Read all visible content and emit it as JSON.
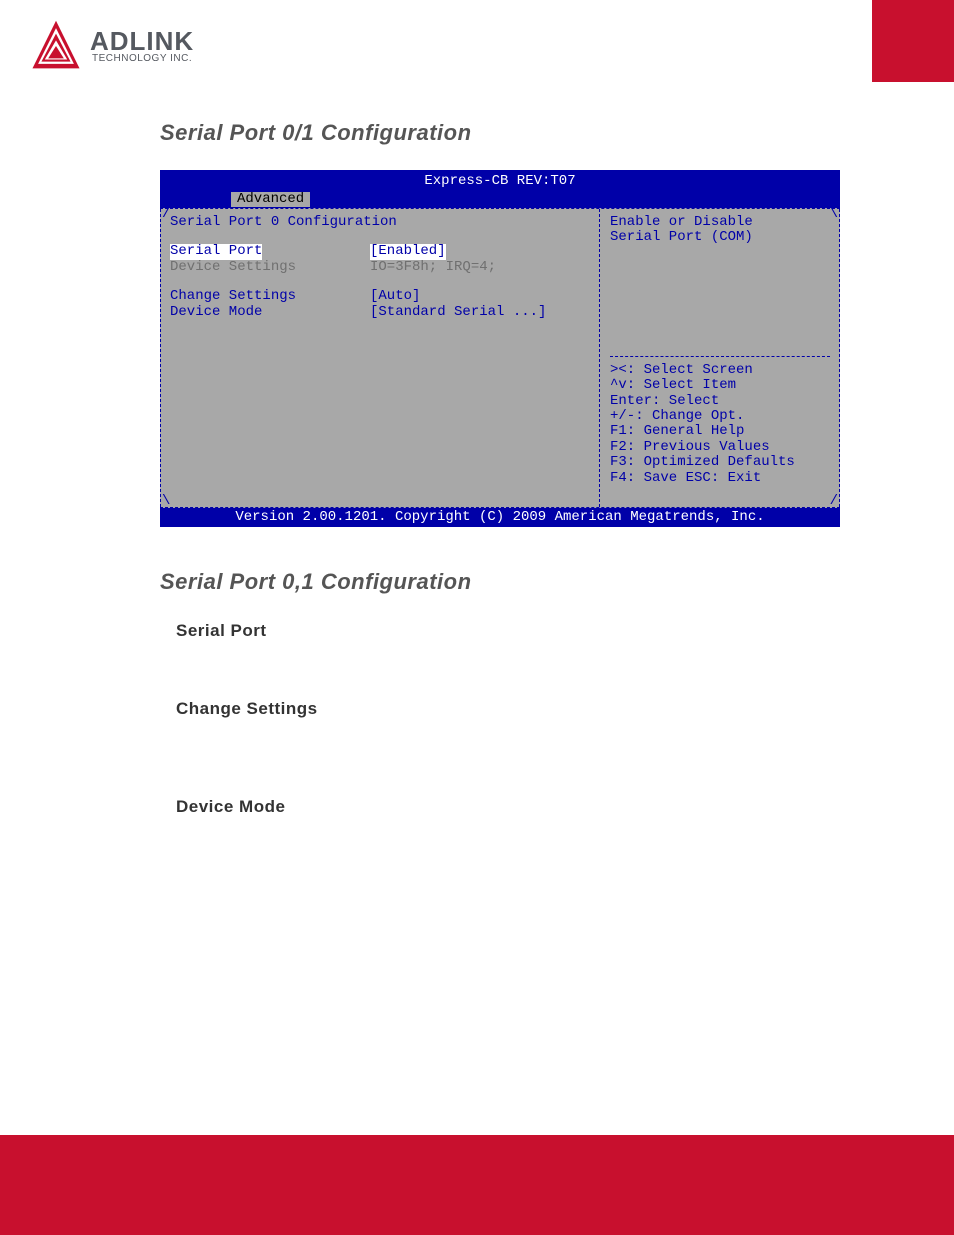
{
  "header": {
    "brand": "ADLINK",
    "subbrand": "TECHNOLOGY INC."
  },
  "doc": {
    "heading1": "Serial Port 0/1 Configuration",
    "heading2": "Serial Port 0,1 Configuration",
    "option1": "Serial Port",
    "option2": "Change Settings",
    "option3": "Device Mode"
  },
  "bios": {
    "title": "Express-CB REV:T07",
    "tab": "Advanced",
    "section_title": "Serial Port 0 Configuration",
    "rows": {
      "serial_port_k": "Serial Port",
      "serial_port_v": "[Enabled]",
      "device_settings_k": "Device Settings",
      "device_settings_v": "IO=3F8h; IRQ=4;",
      "change_settings_k": "Change Settings",
      "change_settings_v": "[Auto]",
      "device_mode_k": "Device Mode",
      "device_mode_v": "[Standard Serial ...]"
    },
    "help_top1": "Enable or Disable",
    "help_top2": "Serial Port (COM)",
    "nav": {
      "l1": "><: Select Screen",
      "l2": "^v: Select Item",
      "l3": "Enter: Select",
      "l4": "+/-: Change Opt.",
      "l5": "F1: General Help",
      "l6": "F2: Previous Values",
      "l7": "F3: Optimized Defaults",
      "l8": "F4: Save  ESC: Exit"
    },
    "footer": "Version 2.00.1201. Copyright (C) 2009 American Megatrends, Inc."
  }
}
